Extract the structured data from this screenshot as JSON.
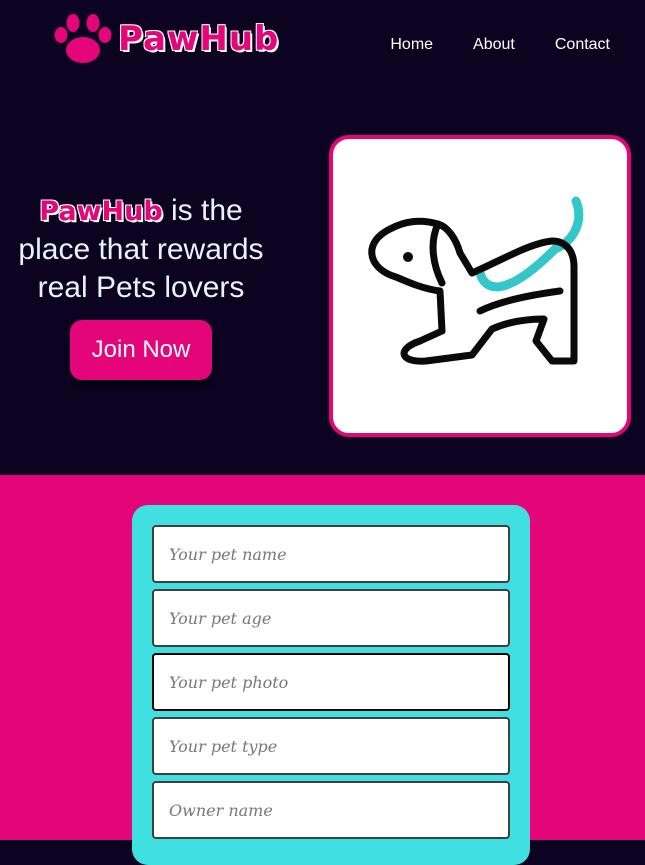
{
  "header": {
    "brand": "PawHub",
    "nav": [
      {
        "label": "Home"
      },
      {
        "label": "About"
      },
      {
        "label": "Contact"
      }
    ]
  },
  "hero": {
    "brand_inline": "PawHub",
    "headline_rest_1": " is the",
    "headline_line_2": "place that rewards",
    "headline_line_3": "real Pets lovers",
    "cta_label": "Join Now"
  },
  "form": {
    "fields": [
      {
        "placeholder": "Your pet name"
      },
      {
        "placeholder": "Your pet age"
      },
      {
        "placeholder": "Your pet photo"
      },
      {
        "placeholder": "Your pet type"
      },
      {
        "placeholder": "Owner name"
      }
    ]
  },
  "colors": {
    "primary": "#e5057a",
    "dark_bg": "#0b0320",
    "accent": "#41e0e0"
  }
}
